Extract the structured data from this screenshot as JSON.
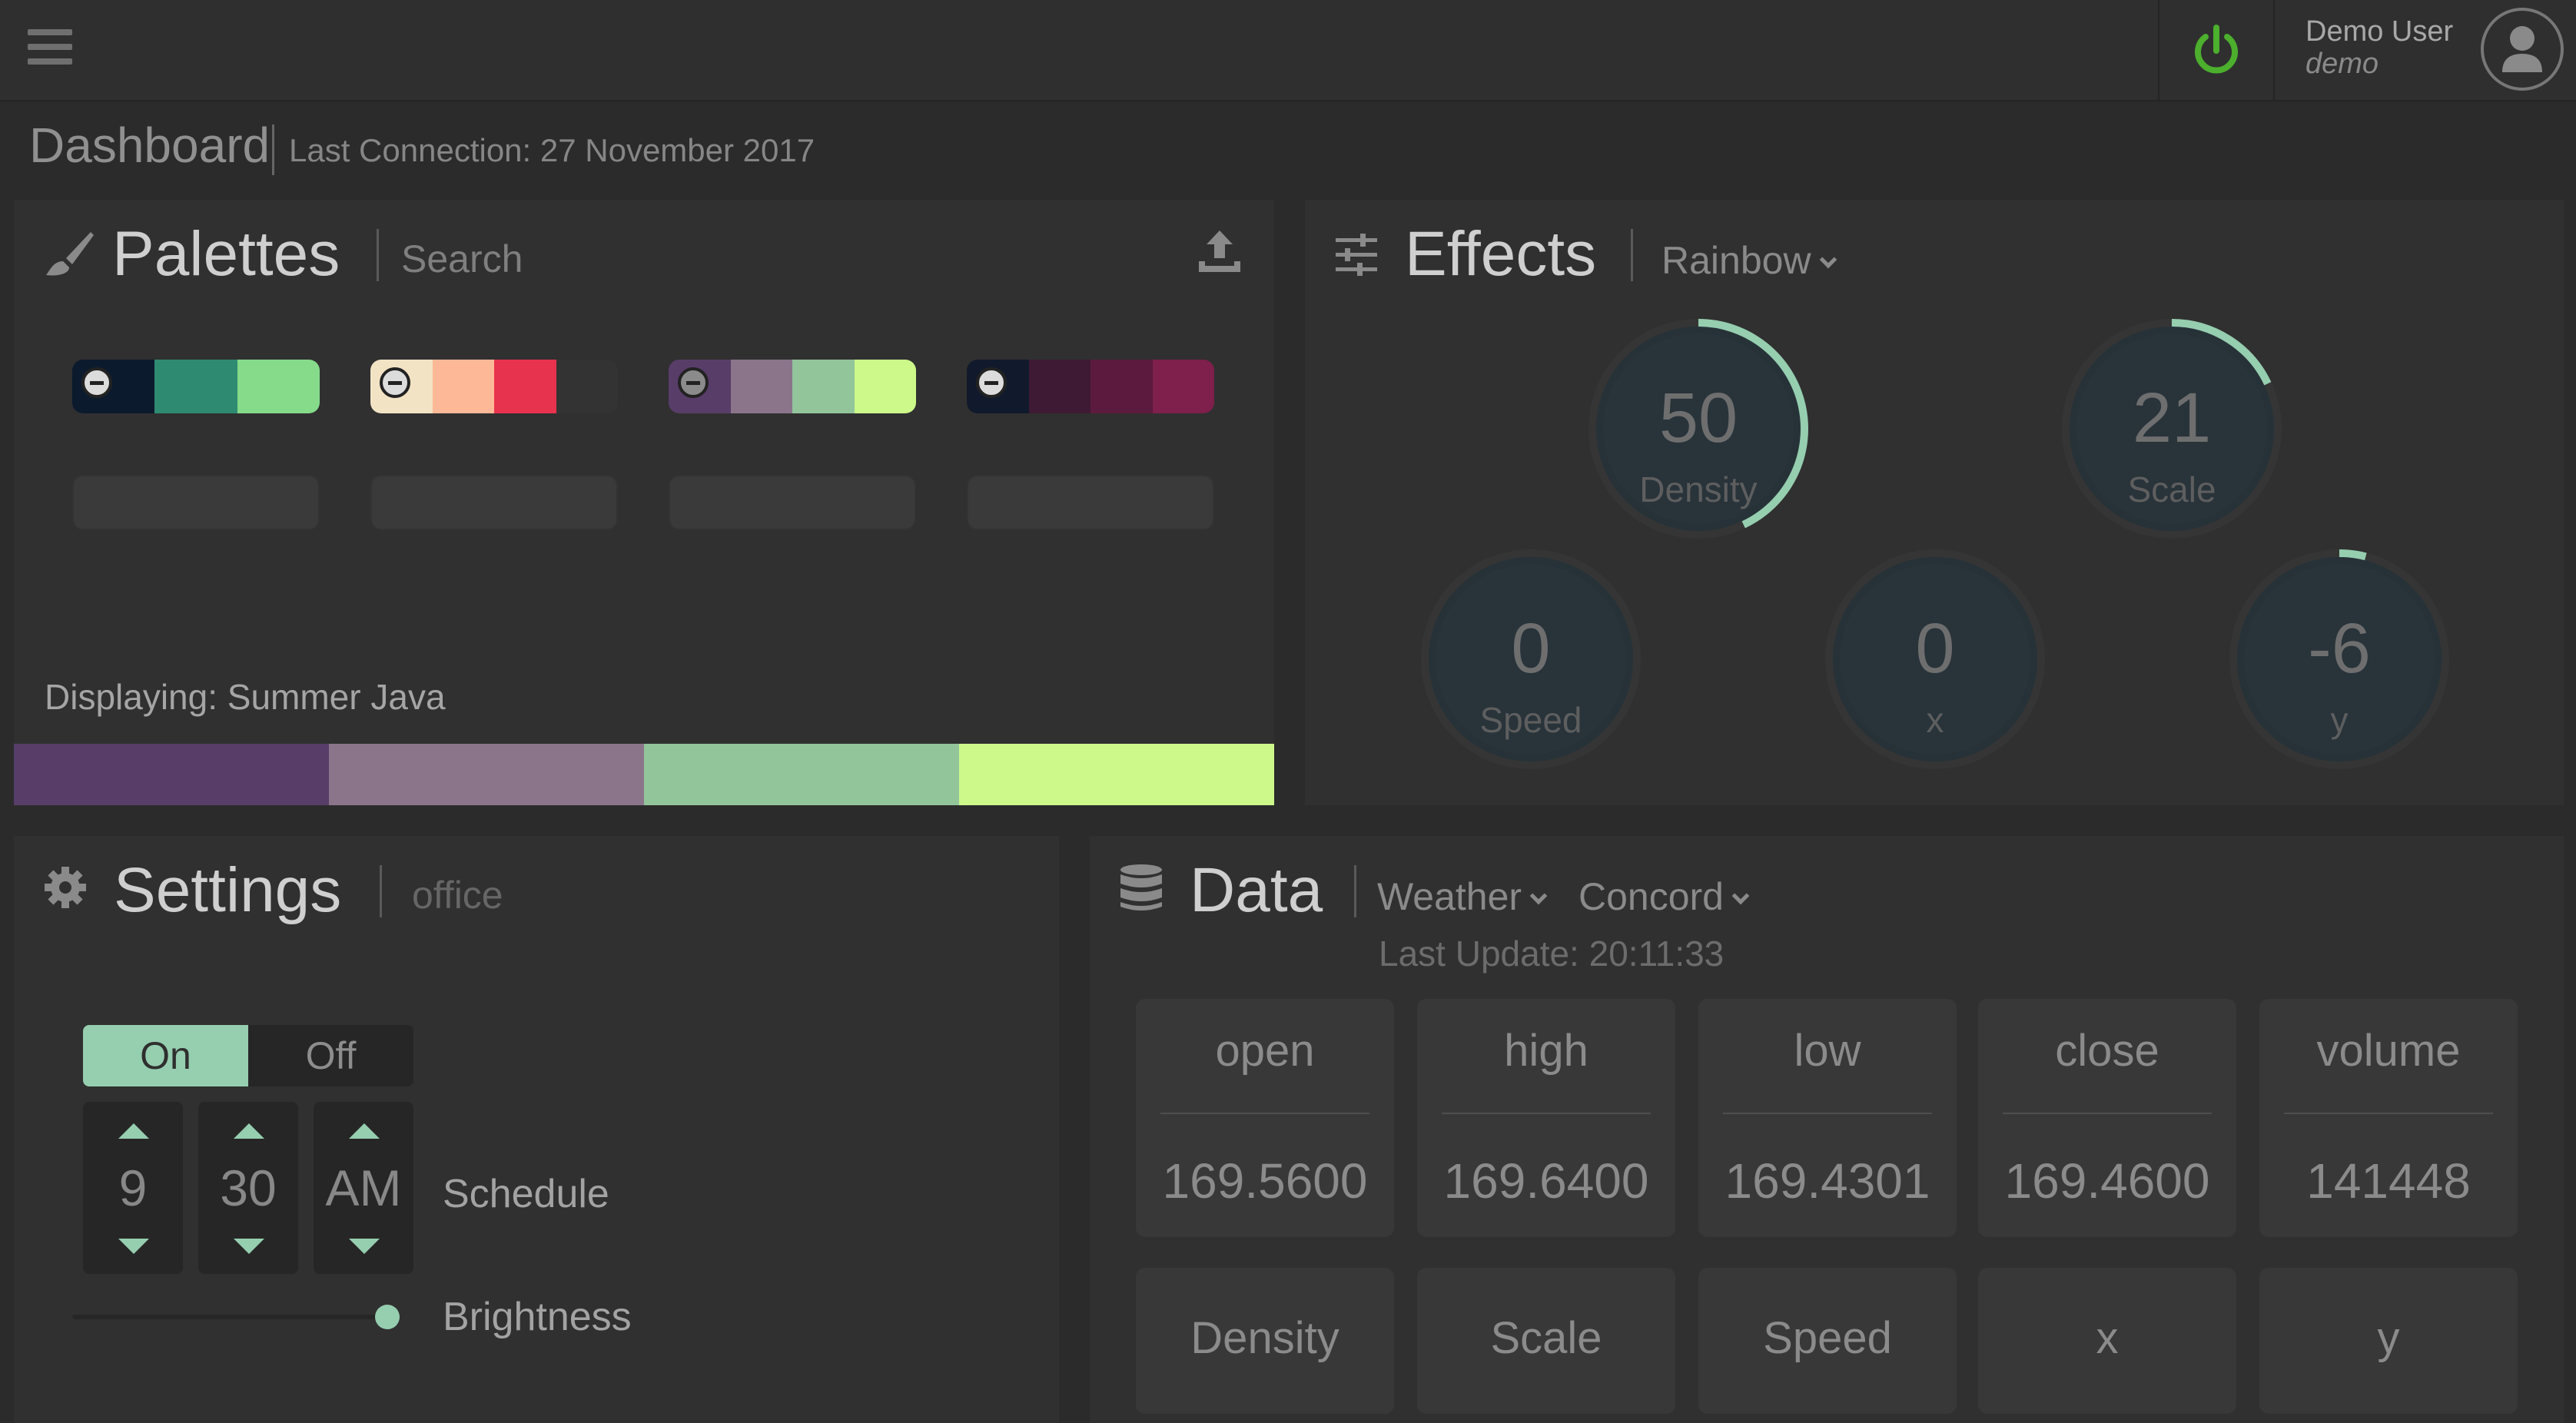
{
  "topbar": {
    "user_name": "Demo User",
    "user_login": "demo",
    "power_color": "#4caf2d"
  },
  "page": {
    "title": "Dashboard",
    "last_connection": "Last Connection: 27 November 2017"
  },
  "palettes": {
    "title": "Palettes",
    "search_placeholder": "Search",
    "swatches": [
      {
        "colors": [
          "#0c1a2e",
          "#2f8a72",
          "#85db8a"
        ]
      },
      {
        "colors": [
          "#f3e3c5",
          "#fdb897",
          "#e8334e",
          "#333333"
        ]
      },
      {
        "colors": [
          "#583d69",
          "#8b758b",
          "#93c59b",
          "#ccf98a"
        ]
      },
      {
        "colors": [
          "#111a2c",
          "#3e1a34",
          "#5c1a3e",
          "#7e1f4c"
        ]
      }
    ],
    "displaying": "Displaying: Summer Java",
    "displayed_colors": [
      "#583d69",
      "#8b758b",
      "#93c59b",
      "#ccf98a"
    ]
  },
  "effects": {
    "title": "Effects",
    "effect": "Rainbow",
    "knobs": [
      {
        "label": "Density",
        "value": "50",
        "fraction": 0.43
      },
      {
        "label": "Scale",
        "value": "21",
        "fraction": 0.18
      },
      {
        "label": "Speed",
        "value": "0",
        "fraction": 0
      },
      {
        "label": "x",
        "value": "0",
        "fraction": 0
      },
      {
        "label": "y",
        "value": "-6",
        "fraction": 0.04
      }
    ],
    "accent": "#96ceb0"
  },
  "settings": {
    "title": "Settings",
    "device": "office",
    "on_label": "On",
    "off_label": "Off",
    "hour": "9",
    "minute": "30",
    "ampm": "AM",
    "schedule_label": "Schedule",
    "brightness_label": "Brightness",
    "brightness": 1.0
  },
  "data": {
    "title": "Data",
    "source": "Weather",
    "location": "Concord",
    "last_update": "Last Update: 20:11:33",
    "cards": [
      {
        "key": "open",
        "value": "169.5600"
      },
      {
        "key": "high",
        "value": "169.6400"
      },
      {
        "key": "low",
        "value": "169.4301"
      },
      {
        "key": "close",
        "value": "169.4600"
      },
      {
        "key": "volume",
        "value": "141448"
      }
    ],
    "buttons": [
      "Density",
      "Scale",
      "Speed",
      "x",
      "y"
    ]
  }
}
